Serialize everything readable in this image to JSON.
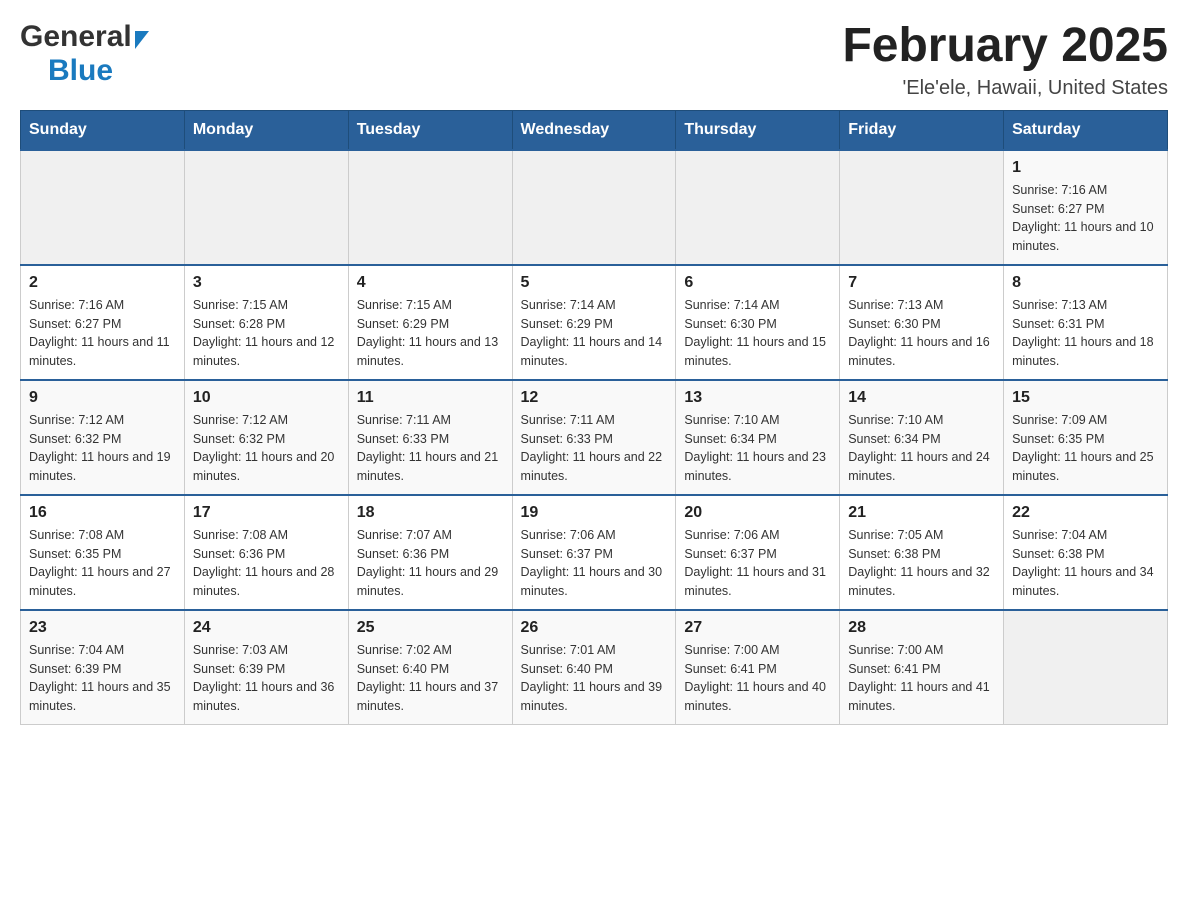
{
  "header": {
    "logo_general": "General",
    "logo_blue": "Blue",
    "month_title": "February 2025",
    "location": "'Ele'ele, Hawaii, United States"
  },
  "days_of_week": [
    "Sunday",
    "Monday",
    "Tuesday",
    "Wednesday",
    "Thursday",
    "Friday",
    "Saturday"
  ],
  "weeks": [
    {
      "days": [
        {
          "num": "",
          "info": ""
        },
        {
          "num": "",
          "info": ""
        },
        {
          "num": "",
          "info": ""
        },
        {
          "num": "",
          "info": ""
        },
        {
          "num": "",
          "info": ""
        },
        {
          "num": "",
          "info": ""
        },
        {
          "num": "1",
          "info": "Sunrise: 7:16 AM\nSunset: 6:27 PM\nDaylight: 11 hours and 10 minutes."
        }
      ]
    },
    {
      "days": [
        {
          "num": "2",
          "info": "Sunrise: 7:16 AM\nSunset: 6:27 PM\nDaylight: 11 hours and 11 minutes."
        },
        {
          "num": "3",
          "info": "Sunrise: 7:15 AM\nSunset: 6:28 PM\nDaylight: 11 hours and 12 minutes."
        },
        {
          "num": "4",
          "info": "Sunrise: 7:15 AM\nSunset: 6:29 PM\nDaylight: 11 hours and 13 minutes."
        },
        {
          "num": "5",
          "info": "Sunrise: 7:14 AM\nSunset: 6:29 PM\nDaylight: 11 hours and 14 minutes."
        },
        {
          "num": "6",
          "info": "Sunrise: 7:14 AM\nSunset: 6:30 PM\nDaylight: 11 hours and 15 minutes."
        },
        {
          "num": "7",
          "info": "Sunrise: 7:13 AM\nSunset: 6:30 PM\nDaylight: 11 hours and 16 minutes."
        },
        {
          "num": "8",
          "info": "Sunrise: 7:13 AM\nSunset: 6:31 PM\nDaylight: 11 hours and 18 minutes."
        }
      ]
    },
    {
      "days": [
        {
          "num": "9",
          "info": "Sunrise: 7:12 AM\nSunset: 6:32 PM\nDaylight: 11 hours and 19 minutes."
        },
        {
          "num": "10",
          "info": "Sunrise: 7:12 AM\nSunset: 6:32 PM\nDaylight: 11 hours and 20 minutes."
        },
        {
          "num": "11",
          "info": "Sunrise: 7:11 AM\nSunset: 6:33 PM\nDaylight: 11 hours and 21 minutes."
        },
        {
          "num": "12",
          "info": "Sunrise: 7:11 AM\nSunset: 6:33 PM\nDaylight: 11 hours and 22 minutes."
        },
        {
          "num": "13",
          "info": "Sunrise: 7:10 AM\nSunset: 6:34 PM\nDaylight: 11 hours and 23 minutes."
        },
        {
          "num": "14",
          "info": "Sunrise: 7:10 AM\nSunset: 6:34 PM\nDaylight: 11 hours and 24 minutes."
        },
        {
          "num": "15",
          "info": "Sunrise: 7:09 AM\nSunset: 6:35 PM\nDaylight: 11 hours and 25 minutes."
        }
      ]
    },
    {
      "days": [
        {
          "num": "16",
          "info": "Sunrise: 7:08 AM\nSunset: 6:35 PM\nDaylight: 11 hours and 27 minutes."
        },
        {
          "num": "17",
          "info": "Sunrise: 7:08 AM\nSunset: 6:36 PM\nDaylight: 11 hours and 28 minutes."
        },
        {
          "num": "18",
          "info": "Sunrise: 7:07 AM\nSunset: 6:36 PM\nDaylight: 11 hours and 29 minutes."
        },
        {
          "num": "19",
          "info": "Sunrise: 7:06 AM\nSunset: 6:37 PM\nDaylight: 11 hours and 30 minutes."
        },
        {
          "num": "20",
          "info": "Sunrise: 7:06 AM\nSunset: 6:37 PM\nDaylight: 11 hours and 31 minutes."
        },
        {
          "num": "21",
          "info": "Sunrise: 7:05 AM\nSunset: 6:38 PM\nDaylight: 11 hours and 32 minutes."
        },
        {
          "num": "22",
          "info": "Sunrise: 7:04 AM\nSunset: 6:38 PM\nDaylight: 11 hours and 34 minutes."
        }
      ]
    },
    {
      "days": [
        {
          "num": "23",
          "info": "Sunrise: 7:04 AM\nSunset: 6:39 PM\nDaylight: 11 hours and 35 minutes."
        },
        {
          "num": "24",
          "info": "Sunrise: 7:03 AM\nSunset: 6:39 PM\nDaylight: 11 hours and 36 minutes."
        },
        {
          "num": "25",
          "info": "Sunrise: 7:02 AM\nSunset: 6:40 PM\nDaylight: 11 hours and 37 minutes."
        },
        {
          "num": "26",
          "info": "Sunrise: 7:01 AM\nSunset: 6:40 PM\nDaylight: 11 hours and 39 minutes."
        },
        {
          "num": "27",
          "info": "Sunrise: 7:00 AM\nSunset: 6:41 PM\nDaylight: 11 hours and 40 minutes."
        },
        {
          "num": "28",
          "info": "Sunrise: 7:00 AM\nSunset: 6:41 PM\nDaylight: 11 hours and 41 minutes."
        },
        {
          "num": "",
          "info": ""
        }
      ]
    }
  ]
}
